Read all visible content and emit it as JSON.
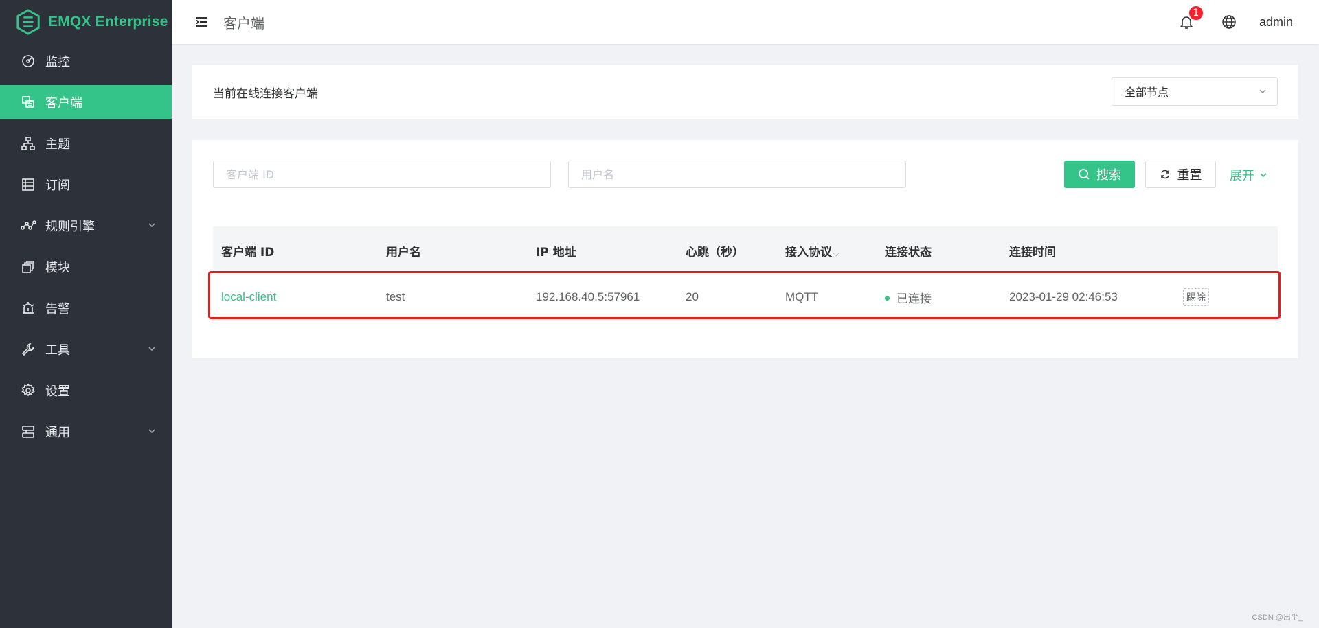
{
  "brand": {
    "name": "EMQX Enterprise",
    "logo_icon": "emqx-hexagon-logo",
    "color": "#34c388"
  },
  "sidebar": {
    "items": [
      {
        "label": "监控",
        "icon": "dashboard-icon",
        "active": false,
        "expandable": false
      },
      {
        "label": "客户端",
        "icon": "clients-icon",
        "active": true,
        "expandable": false
      },
      {
        "label": "主题",
        "icon": "topics-icon",
        "active": false,
        "expandable": false
      },
      {
        "label": "订阅",
        "icon": "subscriptions-icon",
        "active": false,
        "expandable": false
      },
      {
        "label": "规则引擎",
        "icon": "rule-engine-icon",
        "active": false,
        "expandable": true
      },
      {
        "label": "模块",
        "icon": "modules-icon",
        "active": false,
        "expandable": false
      },
      {
        "label": "告警",
        "icon": "alarm-icon",
        "active": false,
        "expandable": false
      },
      {
        "label": "工具",
        "icon": "tools-icon",
        "active": false,
        "expandable": true
      },
      {
        "label": "设置",
        "icon": "settings-icon",
        "active": false,
        "expandable": false
      },
      {
        "label": "通用",
        "icon": "general-icon",
        "active": false,
        "expandable": true
      }
    ]
  },
  "header": {
    "title": "客户端",
    "notification_count": "1",
    "user": "admin"
  },
  "online_card": {
    "title": "当前在线连接客户端",
    "node_select": {
      "value": "全部节点"
    }
  },
  "search": {
    "client_id_placeholder": "客户端 ID",
    "username_placeholder": "用户名",
    "search_label": "搜索",
    "reset_label": "重置",
    "expand_label": "展开"
  },
  "table": {
    "columns": [
      "客户端 ID",
      "用户名",
      "IP 地址",
      "心跳（秒）",
      "接入协议",
      "连接状态",
      "连接时间"
    ],
    "rows": [
      {
        "client_id": "local-client",
        "username": "test",
        "ip": "192.168.40.5:57961",
        "keepalive": "20",
        "protocol": "MQTT",
        "status": "已连接",
        "connected_at": "2023-01-29 02:46:53",
        "action": "踢除"
      }
    ]
  },
  "watermark": "CSDN @出尘_",
  "colors": {
    "accent": "#34c388",
    "sidebar_bg": "#2c313a",
    "badge": "#f5222d",
    "highlight": "#ea1c1c"
  }
}
